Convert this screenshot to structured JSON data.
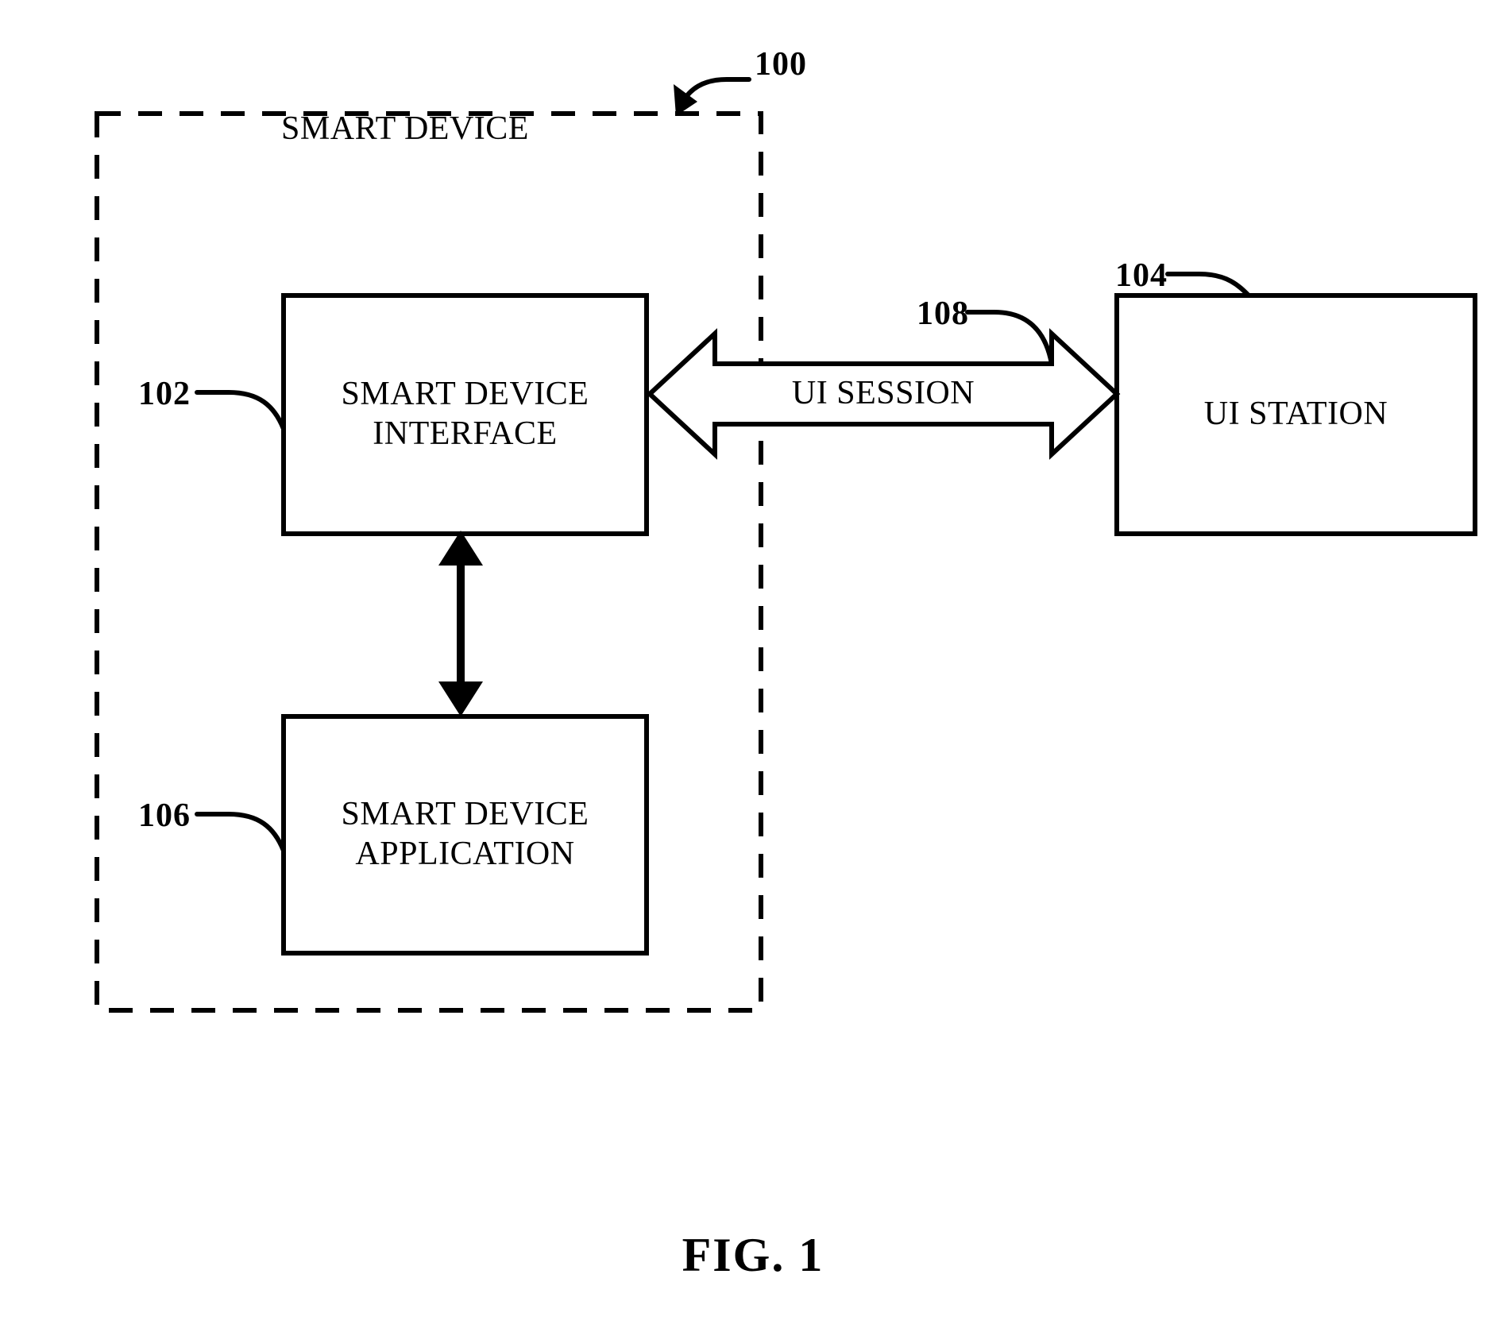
{
  "figure": {
    "caption": "FIG. 1",
    "enclosure": {
      "title": "SMART DEVICE",
      "ref": "100"
    },
    "boxes": [
      {
        "id": "smart-device-interface",
        "line1": "SMART DEVICE",
        "line2": "INTERFACE",
        "ref": "102"
      },
      {
        "id": "smart-device-application",
        "line1": "SMART DEVICE",
        "line2": "APPLICATION",
        "ref": "106"
      },
      {
        "id": "ui-station",
        "line1": "UI STATION",
        "line2": "",
        "ref": "104"
      }
    ],
    "connectors": [
      {
        "id": "ui-session",
        "label": "UI SESSION",
        "ref": "108",
        "style": "hollow-double-arrow",
        "from": "smart-device-interface",
        "to": "ui-station"
      },
      {
        "id": "interface-application-link",
        "label": "",
        "ref": "",
        "style": "solid-double-arrow",
        "from": "smart-device-interface",
        "to": "smart-device-application"
      }
    ],
    "colors": {
      "stroke": "#000000",
      "fill": "#ffffff",
      "background": "#ffffff"
    }
  }
}
